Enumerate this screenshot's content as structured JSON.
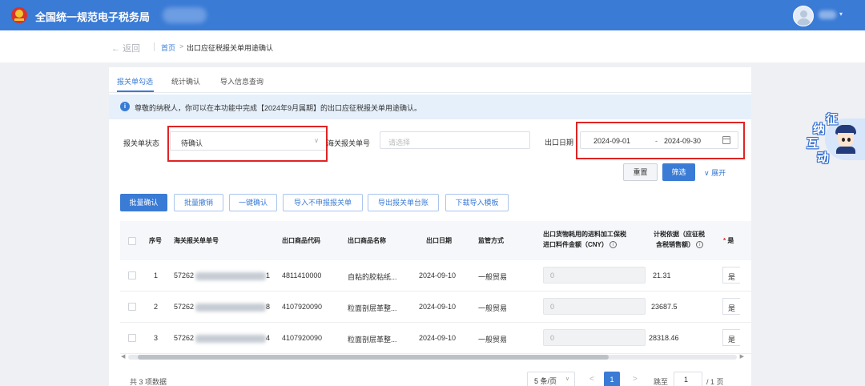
{
  "header": {
    "site_title": "全国统一规范电子税务局"
  },
  "breadcrumb": {
    "back": "返回",
    "home": "首页",
    "separator": ">",
    "current": "出口应征税报关单用途确认"
  },
  "tabs": [
    {
      "label": "报关单勾选",
      "active": true
    },
    {
      "label": "统计确认",
      "active": false
    },
    {
      "label": "导入信息查询",
      "active": false
    }
  ],
  "notice": {
    "icon": "i",
    "text": "尊敬的纳税人，你可以在本功能中完成【2024年9月属期】的出口应征税报关单用途确认。"
  },
  "filters": {
    "status_label": "报关单状态",
    "status_value": "待确认",
    "customs_no_label": "海关报关单号",
    "customs_no_placeholder": "请选择",
    "date_label": "出口日期",
    "date_start": "2024-09-01",
    "date_sep": "-",
    "date_end": "2024-09-30"
  },
  "search_actions": {
    "reset": "重置",
    "query": "筛选",
    "expand": "展开"
  },
  "toolbar": {
    "batch_confirm": "批量确认",
    "batch_revoke": "批量撤销",
    "one_click_confirm": "一键确认",
    "import_not_apply": "导入不申报报关单",
    "export_ledger": "导出报关单台账",
    "download_template": "下载导入模板"
  },
  "table": {
    "headers": {
      "seq": "序号",
      "customs_no": "海关报关单单号",
      "goods_code": "出口商品代码",
      "goods_name": "出口商品名称",
      "export_date": "出口日期",
      "supervision": "监管方式",
      "import_amount_1": "出口货物耗用的进料加工保税",
      "import_amount_2": "进口料件金额（CNY）",
      "tax_basis_1": "计税依据（应征税",
      "tax_basis_2": "含税销售额）",
      "cut_col": "是"
    },
    "rows": [
      {
        "seq": "1",
        "no_prefix": "57262",
        "no_suffix": "1",
        "code": "4811410000",
        "name": "自粘的胶粘纸...",
        "date": "2024-09-10",
        "method": "一般贸易",
        "import_amount": "0",
        "tax_basis": "21.31",
        "cut": "是"
      },
      {
        "seq": "2",
        "no_prefix": "57262",
        "no_suffix": "8",
        "code": "4107920090",
        "name": "粒面剖层革整...",
        "date": "2024-09-10",
        "method": "一般贸易",
        "import_amount": "0",
        "tax_basis": "23687.5",
        "cut": "是"
      },
      {
        "seq": "3",
        "no_prefix": "57262",
        "no_suffix": "4",
        "code": "4107920090",
        "name": "粒面剖层革整...",
        "date": "2024-09-10",
        "method": "一般贸易",
        "import_amount": "0",
        "tax_basis": "28318.46",
        "cut": "是"
      }
    ]
  },
  "pagination": {
    "total": "共 3 项数据",
    "page_size": "5 条/页",
    "prev": "<",
    "current": "1",
    "next": ">",
    "goto_label": "跳至",
    "goto_value": "1",
    "total_pages": "/ 1 页"
  },
  "mascot": {
    "chars": [
      "征",
      "纳",
      "互",
      "动"
    ]
  },
  "colors": {
    "primary": "#3a7bd5",
    "highlight_frame": "#e02424",
    "notice_bg": "#e6f0fb"
  }
}
